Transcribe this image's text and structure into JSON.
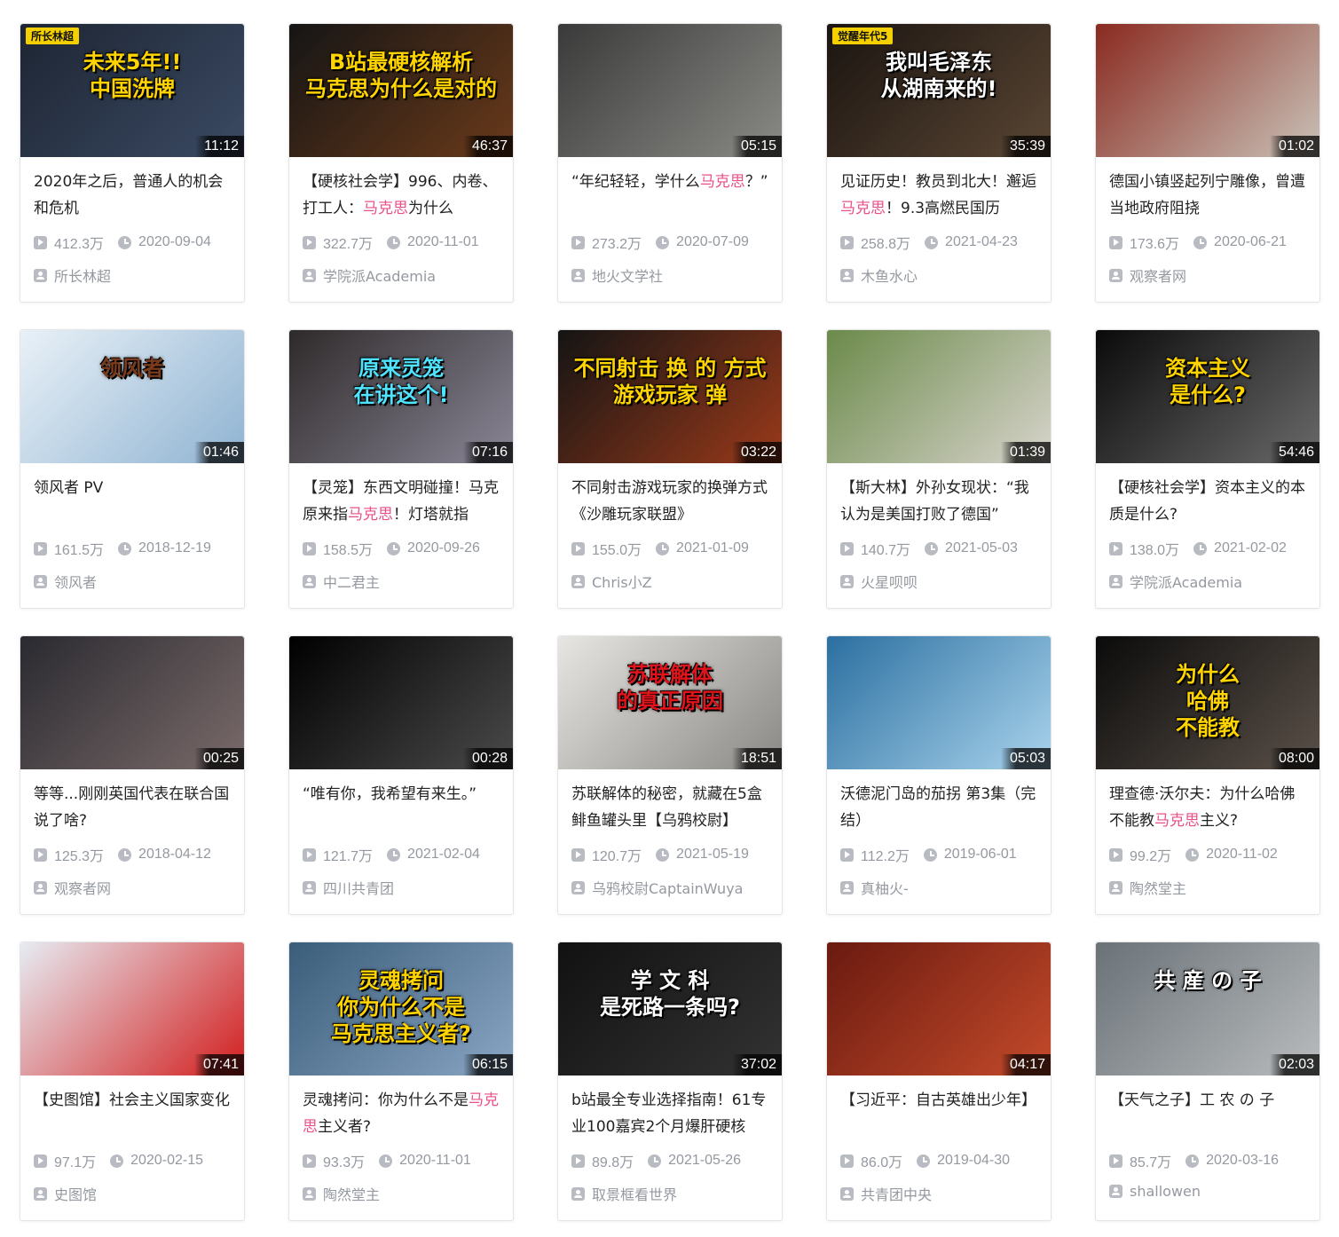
{
  "videos": [
    {
      "thumb_badge": "所长林超",
      "thumb_text": "未来5年!!\n中国洗牌",
      "bg": [
        "#1d2533",
        "#3b4a63"
      ],
      "accent": "#ffd400",
      "duration": "11:12",
      "title": [
        "2020年之后，普通人的机会和危机"
      ],
      "plays": "412.3万",
      "date": "2020-09-04",
      "author": "所长林超"
    },
    {
      "thumb_badge": "",
      "thumb_text": "B站最硬核解析\n马克思为什么是对的",
      "bg": [
        "#151515",
        "#6a3a1a"
      ],
      "accent": "#ffd400",
      "duration": "46:37",
      "title": [
        "【硬核社会学】996、内卷、打工人：",
        "马克思",
        "为什么"
      ],
      "plays": "322.7万",
      "date": "2020-11-01",
      "author": "学院派Academia"
    },
    {
      "thumb_badge": "",
      "thumb_text": "",
      "bg": [
        "#3a3a3a",
        "#8a8a86"
      ],
      "accent": "#ffffff",
      "duration": "05:15",
      "title": [
        "“年纪轻轻，学什么",
        "马克思",
        "？”"
      ],
      "plays": "273.2万",
      "date": "2020-07-09",
      "author": "地火文学社"
    },
    {
      "thumb_badge": "觉醒年代5",
      "thumb_text": "我叫毛泽东\n从湖南来的!",
      "bg": [
        "#1a1410",
        "#5a4634"
      ],
      "accent": "#ffffff",
      "duration": "35:39",
      "title": [
        "见证历史！教员到北大！邂逅",
        "马克思",
        "！9.3高燃民国历"
      ],
      "plays": "258.8万",
      "date": "2021-04-23",
      "author": "木鱼水心"
    },
    {
      "thumb_badge": "",
      "thumb_text": "",
      "bg": [
        "#8a2a20",
        "#c9c2b8"
      ],
      "accent": "#ffffff",
      "duration": "01:02",
      "title": [
        "德国小镇竖起列宁雕像，曾遭当地政府阻挠"
      ],
      "plays": "173.6万",
      "date": "2020-06-21",
      "author": "观察者网"
    },
    {
      "thumb_badge": "",
      "thumb_text": "领风者",
      "bg": [
        "#e9f1f7",
        "#8fb3d2"
      ],
      "accent": "#7a3a1c",
      "duration": "01:46",
      "title": [
        "领风者 PV"
      ],
      "plays": "161.5万",
      "date": "2018-12-19",
      "author": "领风者"
    },
    {
      "thumb_badge": "",
      "thumb_text": "原来灵笼\n在讲这个!",
      "bg": [
        "#2e2a2a",
        "#8a8696"
      ],
      "accent": "#4fe3ff",
      "duration": "07:16",
      "title": [
        "【灵笼】东西文明碰撞！马克原来指",
        "马克思",
        "！灯塔就指"
      ],
      "plays": "158.5万",
      "date": "2020-09-26",
      "author": "中二君主"
    },
    {
      "thumb_badge": "",
      "thumb_text": "不同射击 换 的 方式\n游戏玩家 弹",
      "bg": [
        "#141414",
        "#9a3a1a"
      ],
      "accent": "#ffd400",
      "duration": "03:22",
      "title": [
        "不同射击游戏玩家的换弹方式《沙雕玩家联盟》"
      ],
      "plays": "155.0万",
      "date": "2021-01-09",
      "author": "Chris小Z"
    },
    {
      "thumb_badge": "",
      "thumb_text": "",
      "bg": [
        "#6b8a4a",
        "#d8d4cc"
      ],
      "accent": "#ffffff",
      "duration": "01:39",
      "title": [
        "【斯大林】外孙女现状：“我认为是美国打败了德国”"
      ],
      "plays": "140.7万",
      "date": "2021-05-03",
      "author": "火星呗呗"
    },
    {
      "thumb_badge": "",
      "thumb_text": "资本主义\n是什么?",
      "bg": [
        "#0a0a0a",
        "#6a6a6a"
      ],
      "accent": "#ffd400",
      "duration": "54:46",
      "title": [
        "【硬核社会学】资本主义的本质是什么?"
      ],
      "plays": "138.0万",
      "date": "2021-02-02",
      "author": "学院派Academia"
    },
    {
      "thumb_badge": "",
      "thumb_text": "",
      "bg": [
        "#2a2a30",
        "#7a6a6a"
      ],
      "accent": "#ffffff",
      "duration": "00:25",
      "title": [
        "等等...刚刚英国代表在联合国说了啥?"
      ],
      "plays": "125.3万",
      "date": "2018-04-12",
      "author": "观察者网"
    },
    {
      "thumb_badge": "",
      "thumb_text": "",
      "bg": [
        "#000000",
        "#4a4a4a"
      ],
      "accent": "#ffffff",
      "duration": "00:28",
      "title": [
        "“唯有你，我希望有来生。”"
      ],
      "plays": "121.7万",
      "date": "2021-02-04",
      "author": "四川共青团"
    },
    {
      "thumb_badge": "",
      "thumb_text": "苏联解体\n的真正原因",
      "bg": [
        "#e8e6e2",
        "#8a8884"
      ],
      "accent": "#e0141a",
      "duration": "18:51",
      "title": [
        "苏联解体的秘密，就藏在5盒鲱鱼罐头里【乌鸦校尉】"
      ],
      "plays": "120.7万",
      "date": "2021-05-19",
      "author": "乌鸦校尉CaptainWuya"
    },
    {
      "thumb_badge": "",
      "thumb_text": "",
      "bg": [
        "#2b6fa0",
        "#a9d3ec"
      ],
      "accent": "#ffffff",
      "duration": "05:03",
      "title": [
        "沃德泥门岛的茄拐 第3集（完结）"
      ],
      "plays": "112.2万",
      "date": "2019-06-01",
      "author": "真柚火-"
    },
    {
      "thumb_badge": "",
      "thumb_text": "为什么\n哈佛\n不能教",
      "bg": [
        "#0b0b0b",
        "#5a5048"
      ],
      "accent": "#ffd400",
      "duration": "08:00",
      "title": [
        "理查德·沃尔夫：为什么哈佛不能教",
        "马克思",
        "主义?"
      ],
      "plays": "99.2万",
      "date": "2020-11-02",
      "author": "陶然堂主"
    },
    {
      "thumb_badge": "",
      "thumb_text": "",
      "bg": [
        "#e6ecf3",
        "#d21e1e"
      ],
      "accent": "#d21e1e",
      "duration": "07:41",
      "title": [
        "【史图馆】社会主义国家变化"
      ],
      "plays": "97.1万",
      "date": "2020-02-15",
      "author": "史图馆"
    },
    {
      "thumb_badge": "",
      "thumb_text": "灵魂拷问\n你为什么不是\n马克思主义者?",
      "bg": [
        "#3a5d7a",
        "#8aa6c4"
      ],
      "accent": "#ffd400",
      "duration": "06:15",
      "title": [
        "灵魂拷问：你为什么不是",
        "马克思",
        "主义者?"
      ],
      "plays": "93.3万",
      "date": "2020-11-01",
      "author": "陶然堂主"
    },
    {
      "thumb_badge": "",
      "thumb_text": "学 文 科\n是死路一条吗?",
      "bg": [
        "#111111",
        "#333333"
      ],
      "accent": "#ffffff",
      "duration": "37:02",
      "title": [
        "b站最全专业选择指南！61专业100嘉宾2个月爆肝硬核"
      ],
      "plays": "89.8万",
      "date": "2021-05-26",
      "author": "取景框看世界"
    },
    {
      "thumb_badge": "",
      "thumb_text": "",
      "bg": [
        "#6a1a10",
        "#c44a2a"
      ],
      "accent": "#ffffff",
      "duration": "04:17",
      "title": [
        "【习近平：自古英雄出少年】"
      ],
      "plays": "86.0万",
      "date": "2019-04-30",
      "author": "共青团中央"
    },
    {
      "thumb_badge": "",
      "thumb_text": "共 産 の 子",
      "bg": [
        "#6a7278",
        "#b9bcbd"
      ],
      "accent": "#ffffff",
      "duration": "02:03",
      "title": [
        "【天气之子】工 农 の 子"
      ],
      "plays": "85.7万",
      "date": "2020-03-16",
      "author": "shallowen"
    }
  ]
}
